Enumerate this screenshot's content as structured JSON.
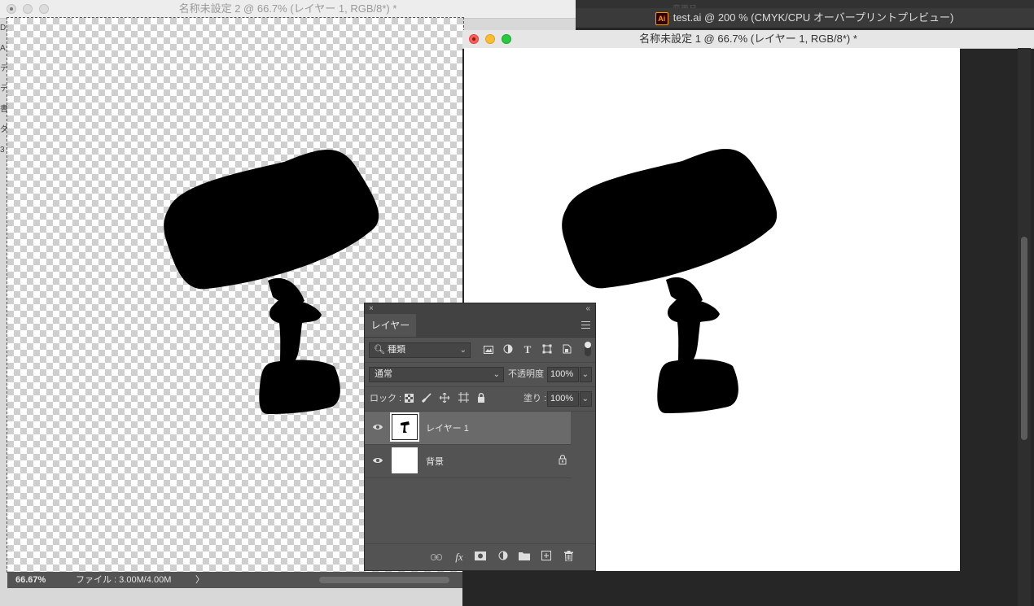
{
  "illustrator_window": {
    "badge": "Ai",
    "title": "test.ai @ 200 % (CMYK/CPU オーバープリントプレビュー)",
    "partial_text": "変更日"
  },
  "doc2": {
    "title": "名称未設定 2 @ 66.7% (レイヤー 1, RGB/8*) *",
    "left_strip_chars": [
      "D",
      "A",
      "デ",
      "テ",
      "書",
      "ダ",
      "3"
    ],
    "status_zoom": "66.67%",
    "status_file": "ファイル : 3.00M/4.00M",
    "status_arrow": "〉"
  },
  "doc1": {
    "title": "名称未設定 1 @ 66.7% (レイヤー 1, RGB/8*) *"
  },
  "layers_panel": {
    "close_glyph": "×",
    "collapse_glyph": "«",
    "tab_label": "レイヤー",
    "filter_kind": "種類",
    "blend_mode": "通常",
    "opacity_label": "不透明度 :",
    "opacity_value": "100%",
    "lock_label": "ロック :",
    "fill_label": "塗り :",
    "fill_value": "100%",
    "layers": [
      {
        "name": "レイヤー 1",
        "selected": true,
        "locked": false
      },
      {
        "name": "背景",
        "selected": false,
        "locked": true
      }
    ]
  },
  "colors": {
    "panel_bg": "#535353",
    "selected_row": "#6a6a6a",
    "close_red": "#fe5f57",
    "minimize_yellow": "#febc2e",
    "zoom_green": "#28c840"
  }
}
